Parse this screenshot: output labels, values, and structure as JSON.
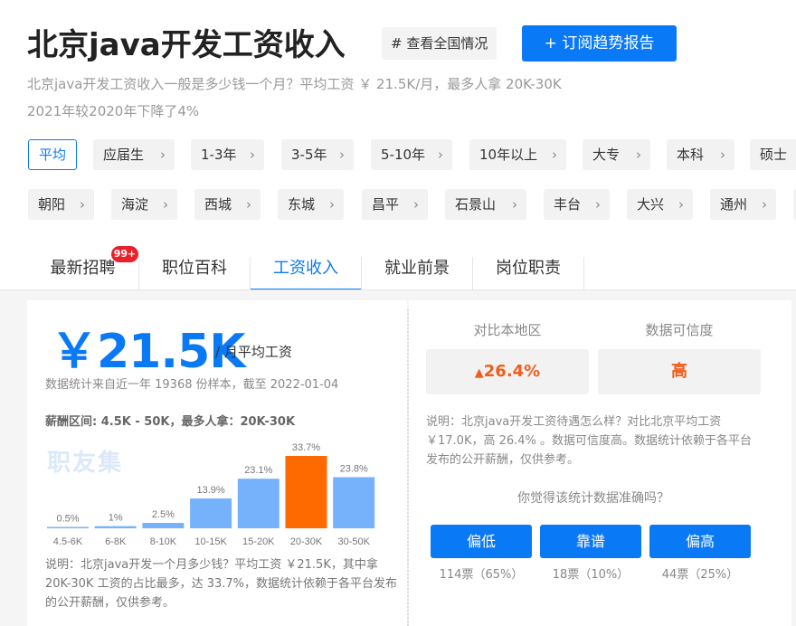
{
  "header": {
    "title": "北京java开发工资收入",
    "tag_button": "# 查看全国情况",
    "subscribe_button": "+ 订阅趋势报告",
    "desc1": "北京java开发工资收入一般是多少钱一个月？平均工资 ￥ 21.5K/月，最多人拿 20K-30K",
    "desc2": "2021年较2020年下降了4%"
  },
  "filters_row1": [
    {
      "label": "平均",
      "active": true
    },
    {
      "label": "应届生"
    },
    {
      "label": "1-3年"
    },
    {
      "label": "3-5年"
    },
    {
      "label": "5-10年"
    },
    {
      "label": "10年以上"
    },
    {
      "label": "大专"
    },
    {
      "label": "本科"
    },
    {
      "label": "硕士"
    }
  ],
  "filters_row2": [
    {
      "label": "朝阳"
    },
    {
      "label": "海淀"
    },
    {
      "label": "西城"
    },
    {
      "label": "东城"
    },
    {
      "label": "昌平"
    },
    {
      "label": "石景山"
    },
    {
      "label": "丰台"
    },
    {
      "label": "大兴"
    },
    {
      "label": "通州"
    }
  ],
  "tabs": [
    {
      "label": "最新招聘"
    },
    {
      "label": "职位百科"
    },
    {
      "label": "工资收入",
      "active": true
    },
    {
      "label": "就业前景"
    },
    {
      "label": "岗位职责"
    }
  ],
  "badge": "99+",
  "salary": {
    "value": "￥21.5K",
    "unit": "/ 月平均工资",
    "stat_note": "数据统计来自近一年 19368 份样本，截至 2022-01-04",
    "range": "薪酬区间: 4.5K - 50K，最多人拿：20K-30K",
    "watermark": "职友集",
    "note": "说明：北京java开发一个月多少钱？平均工资 ￥21.5K，其中拿 20K-30K 工资的占比最多，达 33.7%，数据统计依赖于各平台发布的公开薪酬，仅供参考。"
  },
  "chart_data": {
    "type": "bar",
    "categories": [
      "4.5-6K",
      "6-8K",
      "8-10K",
      "10-15K",
      "15-20K",
      "20-30K",
      "30-50K"
    ],
    "values": [
      0.5,
      1,
      2.5,
      13.9,
      23.1,
      33.7,
      23.8
    ],
    "value_labels": [
      "0.5%",
      "1%",
      "2.5%",
      "13.9%",
      "23.1%",
      "33.7%",
      "23.8%"
    ],
    "highlight_index": 5,
    "colors": {
      "normal": "#75b2fb",
      "highlight": "#ff6a00"
    },
    "ylim": [
      0,
      33.7
    ]
  },
  "compare": {
    "head_region": "对比本地区",
    "head_reliability": "数据可信度",
    "region_value": "26.4%",
    "region_icon": "up-arrow-icon",
    "reliability_value": "高",
    "desc": "说明：北京java开发工资待遇怎么样？对比北京平均工资 ￥17.0K，高 26.4% 。数据可信度高。数据统计依赖于各平台发布的公开薪酬，仅供参考。",
    "question": "你觉得该统计数据准确吗？"
  },
  "votes": [
    {
      "label": "偏低",
      "count": "114票（65%）"
    },
    {
      "label": "靠谱",
      "count": "18票（10%）"
    },
    {
      "label": "偏高",
      "count": "44票（25%）"
    }
  ]
}
